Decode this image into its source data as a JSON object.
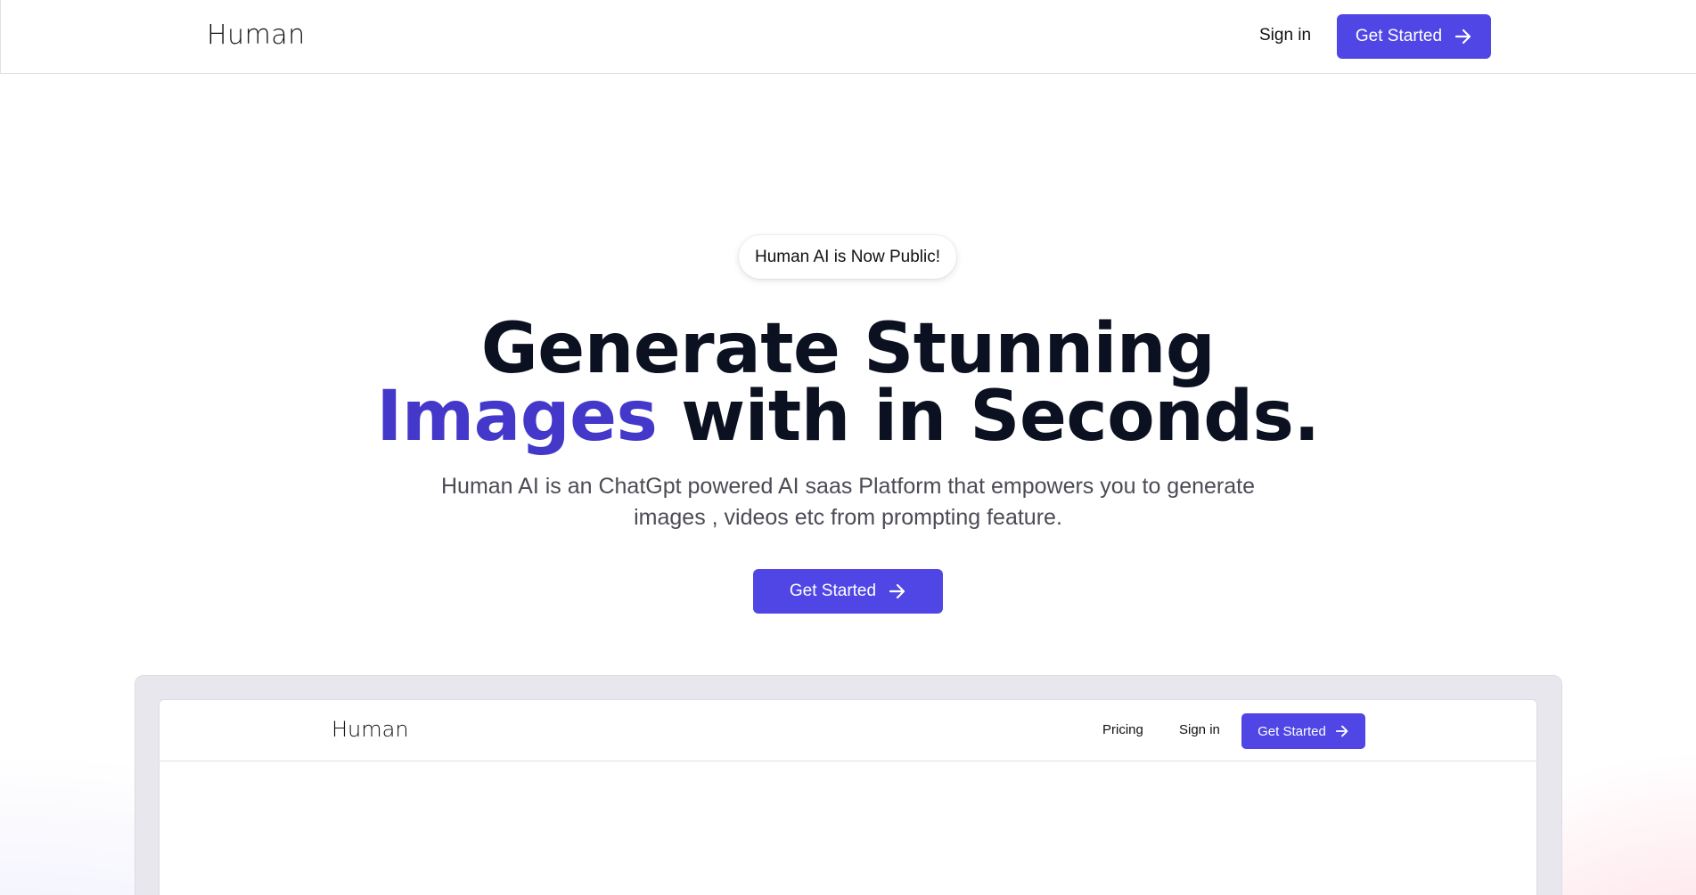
{
  "brand": {
    "logo_text": "Human",
    "accent_color": "#4f46e5",
    "headline_accent_color": "#4338ca"
  },
  "nav": {
    "signin_label": "Sign in",
    "get_started_label": "Get Started"
  },
  "hero": {
    "announcement": "Human AI is Now Public!",
    "headline_line1": "Generate Stunning",
    "headline_accent": "Images",
    "headline_line2_rest": " with in Seconds.",
    "subtext_line1": "Human AI is an ChatGpt powered AI saas Platform that empowers you to generate",
    "subtext_line2": "images , videos etc from prompting feature.",
    "cta_label": "Get Started"
  },
  "preview": {
    "logo_text": "Human",
    "pricing_label": "Pricing",
    "signin_label": "Sign in",
    "get_started_label": "Get Started"
  },
  "icons": {
    "cta_icon": "arrow-right-icon"
  }
}
